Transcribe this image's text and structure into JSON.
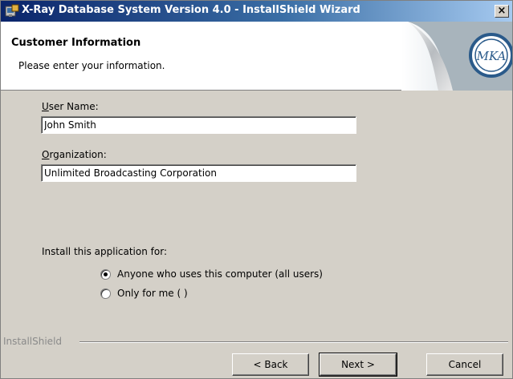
{
  "window": {
    "title": "X-Ray Database System Version 4.0 - InstallShield Wizard",
    "close_label": "×"
  },
  "banner": {
    "title": "Customer Information",
    "subtitle": "Please enter your information.",
    "logo_text": "MKA"
  },
  "form": {
    "user_name": {
      "label_accel": "U",
      "label_rest": "ser Name:",
      "value": "John Smith"
    },
    "organization": {
      "label_accel": "O",
      "label_rest": "rganization:",
      "value": "Unlimited Broadcasting Corporation"
    }
  },
  "install_for": {
    "label": "Install this application for:",
    "options": [
      {
        "label": "Anyone who uses this computer (all users)",
        "selected": true
      },
      {
        "label": "Only for me ( )",
        "selected": false
      }
    ]
  },
  "footer": {
    "brand": "InstallShield",
    "back_label": "< Back",
    "next_label": "Next >",
    "cancel_label": "Cancel"
  }
}
